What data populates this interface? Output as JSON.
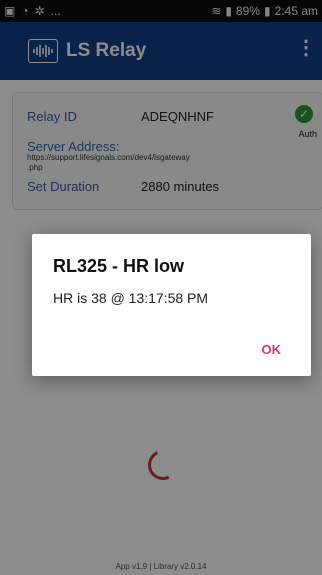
{
  "status_bar": {
    "battery": "89%",
    "time": "2:45 am",
    "ellipsis": "..."
  },
  "app_bar": {
    "title": "LS Relay",
    "menu_icon": "⋮"
  },
  "info_card": {
    "relay_id_label": "Relay ID",
    "relay_id_value": "ADEQNHNF",
    "server_address_label": "Server Address:",
    "server_address_value": "https://support.lifesignals.com/dev4/lsgateway",
    "server_address_value_2": ".php",
    "set_duration_label": "Set Duration",
    "set_duration_value": "2880 minutes",
    "auth_label": "Auth"
  },
  "dialog": {
    "title": "RL325 - HR low",
    "message": "HR is 38 @ 13:17:58 PM",
    "ok_label": "OK"
  },
  "footer": {
    "text": "App v1.9  |  Library v2.0.14"
  },
  "colors": {
    "app_bar": "#0f3f87",
    "accent_pink": "#e0347a",
    "label_blue": "#3b5ea8",
    "auth_green": "#2e9b3a"
  }
}
